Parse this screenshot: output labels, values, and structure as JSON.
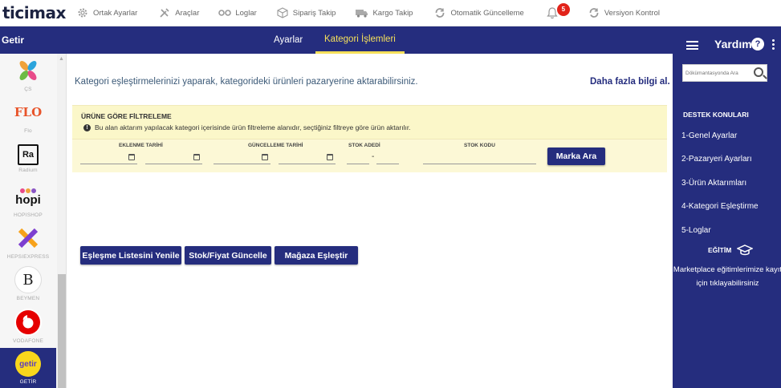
{
  "topbar": {
    "logo": "ticimax",
    "menu": [
      {
        "label": "Ortak Ayarlar",
        "icon": "gear-icon"
      },
      {
        "label": "Araçlar",
        "icon": "tools-icon"
      },
      {
        "label": "Loglar",
        "icon": "log-icon"
      },
      {
        "label": "Sipariş Takip",
        "icon": "package-icon"
      },
      {
        "label": "Kargo Takip",
        "icon": "truck-icon"
      },
      {
        "label": "Otomatik Güncelleme",
        "icon": "refresh-icon"
      },
      {
        "label": "",
        "icon": "bell-icon",
        "badge": "5"
      },
      {
        "label": "Versiyon Kontrol",
        "icon": "refresh-icon"
      }
    ]
  },
  "header": {
    "title": "Getir",
    "tabs": [
      {
        "label": "Ayarlar",
        "active": false
      },
      {
        "label": "Kategori İşlemleri",
        "active": true
      }
    ]
  },
  "sidebar": {
    "items": [
      {
        "label": "ÇS",
        "logo": "✕",
        "color": "#f0a23a"
      },
      {
        "label": "Flo",
        "logo": "FLO",
        "color": "#e8542a"
      },
      {
        "label": "Radium",
        "logo": "Ra",
        "color": "#111111"
      },
      {
        "label": "HOPISHOP",
        "logo": "hopi",
        "color": "#111111"
      },
      {
        "label": "HEPSIEXPRESS",
        "logo": "X",
        "color": "#f7a21b"
      },
      {
        "label": "BEYMEN",
        "logo": "B",
        "color": "#222222"
      },
      {
        "label": "VODAFONE",
        "logo": "◐",
        "color": "#e60000"
      },
      {
        "label": "GETİR",
        "logo": "getir",
        "color": "#f9d71c",
        "active": true
      }
    ]
  },
  "main": {
    "intro": "Kategori eşleştirmelerinizi yaparak, kategorideki ürünleri pazaryerine aktarabilirsiniz.",
    "more_info": "Daha fazla bilgi al.",
    "filter": {
      "title": "ÜRÜNE GÖRE FİLTRELEME",
      "note": "Bu alan aktarım yapılacak kategori içerisinde ürün filtreleme alanıdır, seçtiğiniz filtreye göre ürün aktarılır.",
      "labels": {
        "added_date": "EKLENME TARİHİ",
        "updated_date": "GÜNCELLEME TARİHİ",
        "stock_qty": "STOK ADEDİ",
        "stock_code": "STOK KODU"
      },
      "search_button": "Marka Ara"
    },
    "actions": {
      "refresh": "Eşleşme Listesini Yenile",
      "update": "Stok/Fiyat Güncelle",
      "match": "Mağaza Eşleştir"
    }
  },
  "help": {
    "title": "Yardım",
    "search_placeholder": "Dökümantasyonda Ara",
    "section": "DESTEK KONULARI",
    "links": [
      "1-Genel Ayarlar",
      "2-Pazaryeri Ayarları",
      "3-Ürün Aktarımları",
      "4-Kategori Eşleştirme",
      "5-Loglar"
    ],
    "education_title": "EĞİTİM",
    "education_text_1": "Marketplace eğitimlerimize kayıt",
    "education_text_2": "için tıklayabilirsiniz"
  },
  "colors": {
    "primary": "#252d7e",
    "active_tab": "#f5e05a",
    "filter_bg": "#fcf8d6",
    "badge": "#e2231a"
  }
}
